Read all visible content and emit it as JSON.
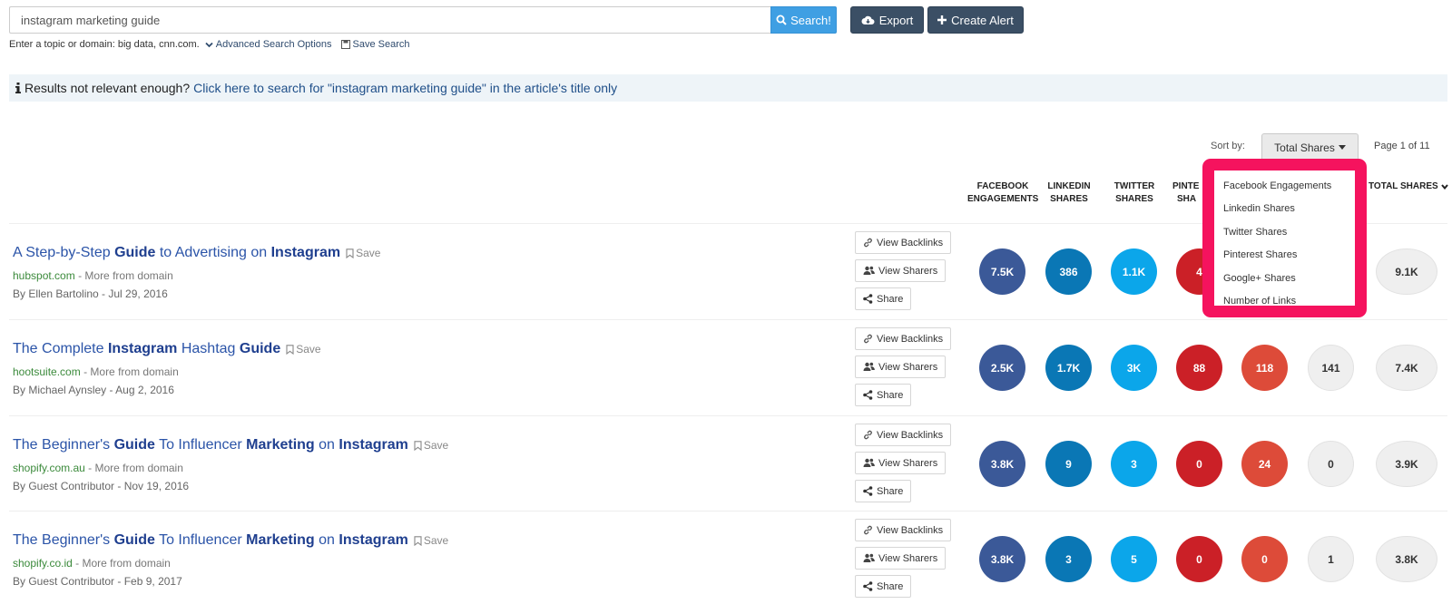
{
  "search": {
    "value": "instagram marketing guide",
    "button_label": "Search!",
    "export_label": "Export",
    "alert_label": "Create Alert",
    "hint": "Enter a topic or domain: big data, cnn.com.",
    "advanced_label": "Advanced Search Options",
    "save_search_label": "Save Search"
  },
  "banner": {
    "prefix": "Results not relevant enough?",
    "link": "Click here to search for \"instagram marketing guide\" in the article's title only"
  },
  "sort": {
    "label": "Sort by:",
    "selected": "Total Shares",
    "page": "Page 1 of 11",
    "options": [
      "Facebook Engagements",
      "Linkedin Shares",
      "Twitter Shares",
      "Pinterest Shares",
      "Google+ Shares",
      "Number of Links"
    ]
  },
  "columns": {
    "facebook": [
      "FACEBOOK",
      "ENGAGEMENTS"
    ],
    "linkedin": [
      "LINKEDIN",
      "SHARES"
    ],
    "twitter": [
      "TWITTER",
      "SHARES"
    ],
    "pinterest": [
      "PINTE",
      "SHA"
    ],
    "total": "TOTAL SHARES"
  },
  "actions": {
    "backlinks": "View Backlinks",
    "sharers": "View Sharers",
    "share": "Share",
    "save": "Save",
    "more_from_domain": "- More from domain"
  },
  "colors": {
    "facebook": "#3b5998",
    "linkedin": "#0a77b5",
    "twitter": "#0ba6ea",
    "pinterest": "#cb2027",
    "googleplus": "#dd4b39",
    "highlight": "#f5135e"
  },
  "results": [
    {
      "title_parts": [
        "A Step-by-Step ",
        "Guide",
        " to Advertising on ",
        "Instagram"
      ],
      "domain": "hubspot.com",
      "byline": "By Ellen Bartolino - Jul 29, 2016",
      "facebook": "7.5K",
      "linkedin": "386",
      "twitter": "1.1K",
      "pinterest": "4",
      "googleplus": "",
      "links": "",
      "total": "9.1K"
    },
    {
      "title_parts": [
        "The Complete ",
        "Instagram",
        " Hashtag ",
        "Guide"
      ],
      "domain": "hootsuite.com",
      "byline": "By Michael Aynsley - Aug 2, 2016",
      "facebook": "2.5K",
      "linkedin": "1.7K",
      "twitter": "3K",
      "pinterest": "88",
      "googleplus": "118",
      "links": "141",
      "total": "7.4K"
    },
    {
      "title_parts": [
        "The Beginner's ",
        "Guide",
        " To Influencer ",
        "Marketing",
        " on ",
        "Instagram"
      ],
      "domain": "shopify.com.au",
      "byline": "By Guest Contributor - Nov 19, 2016",
      "facebook": "3.8K",
      "linkedin": "9",
      "twitter": "3",
      "pinterest": "0",
      "googleplus": "24",
      "links": "0",
      "total": "3.9K"
    },
    {
      "title_parts": [
        "The Beginner's ",
        "Guide",
        " To Influencer ",
        "Marketing",
        " on ",
        "Instagram"
      ],
      "domain": "shopify.co.id",
      "byline": "By Guest Contributor - Feb 9, 2017",
      "facebook": "3.8K",
      "linkedin": "3",
      "twitter": "5",
      "pinterest": "0",
      "googleplus": "0",
      "links": "1",
      "total": "3.8K"
    }
  ]
}
